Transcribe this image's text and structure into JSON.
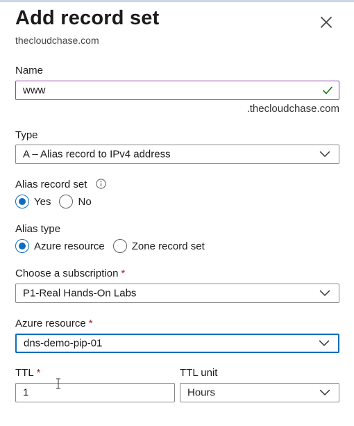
{
  "panel": {
    "title": "Add record set",
    "subtitle": "thecloudchase.com",
    "close_icon": "close-icon"
  },
  "name_field": {
    "label": "Name",
    "value": "www",
    "suffix": ".thecloudchase.com",
    "valid_icon": "checkmark-icon"
  },
  "type_field": {
    "label": "Type",
    "value": "A – Alias record to IPv4 address"
  },
  "alias_record_set": {
    "label": "Alias record set",
    "info_icon": "info-icon",
    "options": [
      {
        "label": "Yes",
        "selected": true
      },
      {
        "label": "No",
        "selected": false
      }
    ]
  },
  "alias_type": {
    "label": "Alias type",
    "options": [
      {
        "label": "Azure resource",
        "selected": true
      },
      {
        "label": "Zone record set",
        "selected": false
      }
    ]
  },
  "subscription_field": {
    "label": "Choose a subscription",
    "required_mark": "*",
    "value": "P1-Real Hands-On Labs"
  },
  "azure_resource_field": {
    "label": "Azure resource",
    "required_mark": "*",
    "value": "dns-demo-pip-01"
  },
  "ttl_field": {
    "label": "TTL",
    "required_mark": "*",
    "value": "1"
  },
  "ttl_unit_field": {
    "label": "TTL unit",
    "value": "Hours"
  },
  "colors": {
    "accent": "#0f6cbd",
    "required": "#a4262c",
    "valid": "#107c10",
    "name_border": "#8e44ad"
  }
}
